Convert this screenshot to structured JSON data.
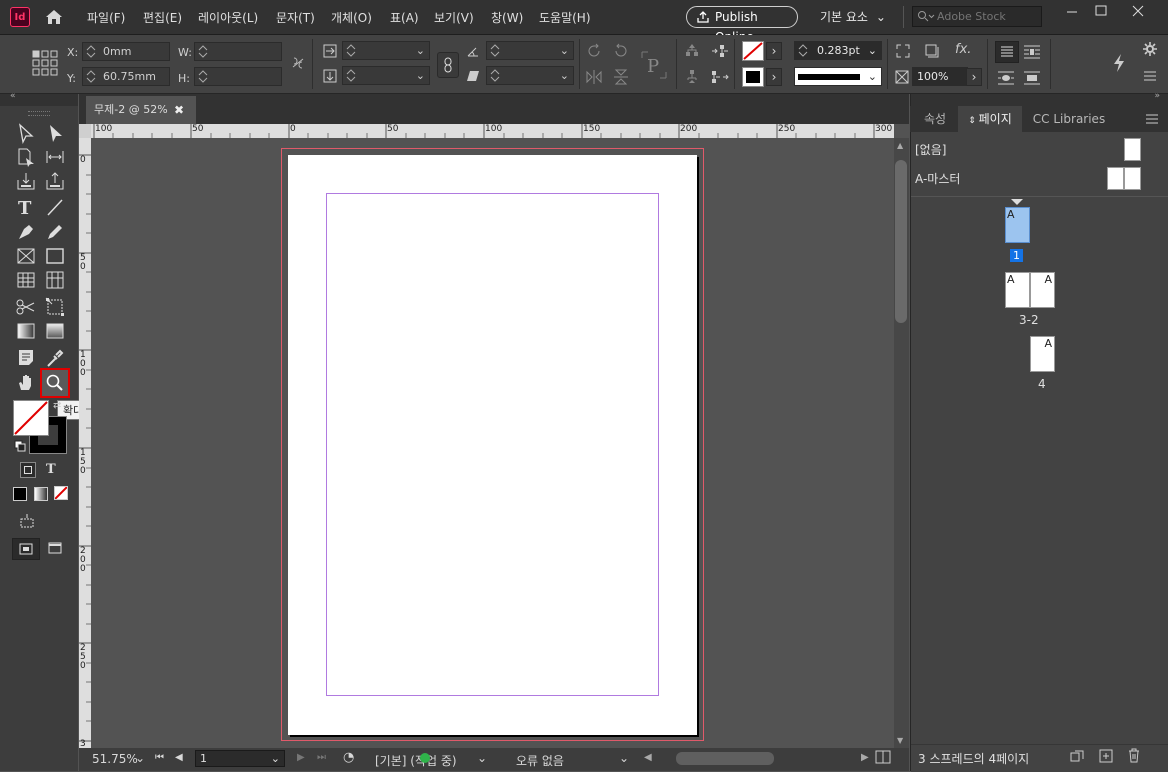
{
  "app": {
    "logo": "Id"
  },
  "menu": [
    "파일(F)",
    "편집(E)",
    "레이아웃(L)",
    "문자(T)",
    "개체(O)",
    "표(A)",
    "보기(V)",
    "창(W)",
    "도움말(H)"
  ],
  "header": {
    "publish_label": "Publish Online",
    "workspace_label": "기본 요소",
    "stock_placeholder": "Adobe Stock"
  },
  "control": {
    "x_label": "X:",
    "x_value": "0mm",
    "y_label": "Y:",
    "y_value": "60.75mm",
    "w_label": "W:",
    "h_label": "H:",
    "stroke_weight": "0.283pt",
    "opacity": "100%"
  },
  "document": {
    "tab_label": "무제-2 @ 52%"
  },
  "ruler": {
    "top": [
      "100",
      "50",
      "0",
      "50",
      "100",
      "150",
      "200",
      "250",
      "300"
    ],
    "left": [
      "0",
      "5 0",
      "1 0 0",
      "1 5 0",
      "2 0 0",
      "2 5 0",
      "3"
    ]
  },
  "tooltip": {
    "text": "확대/축소 도구 (Z)"
  },
  "status": {
    "zoom": "51.75%",
    "page": "1",
    "profile": "[기본] (작업 중)",
    "errors": "오류 없음"
  },
  "panel": {
    "tabs": [
      "속성",
      "페이지",
      "CC Libraries"
    ],
    "none_label": "[없음]",
    "master_label": "A-마스터",
    "master_letter": "A",
    "pages": [
      {
        "label": "1"
      },
      {
        "label": "3-2"
      },
      {
        "label": "4"
      }
    ],
    "footer_text": "3 스프레드의 4페이지"
  },
  "colors": {
    "accent": "#e00000",
    "selected": "#1473e6",
    "bleed": "#e05a6a",
    "margin": "#b07ae0"
  }
}
